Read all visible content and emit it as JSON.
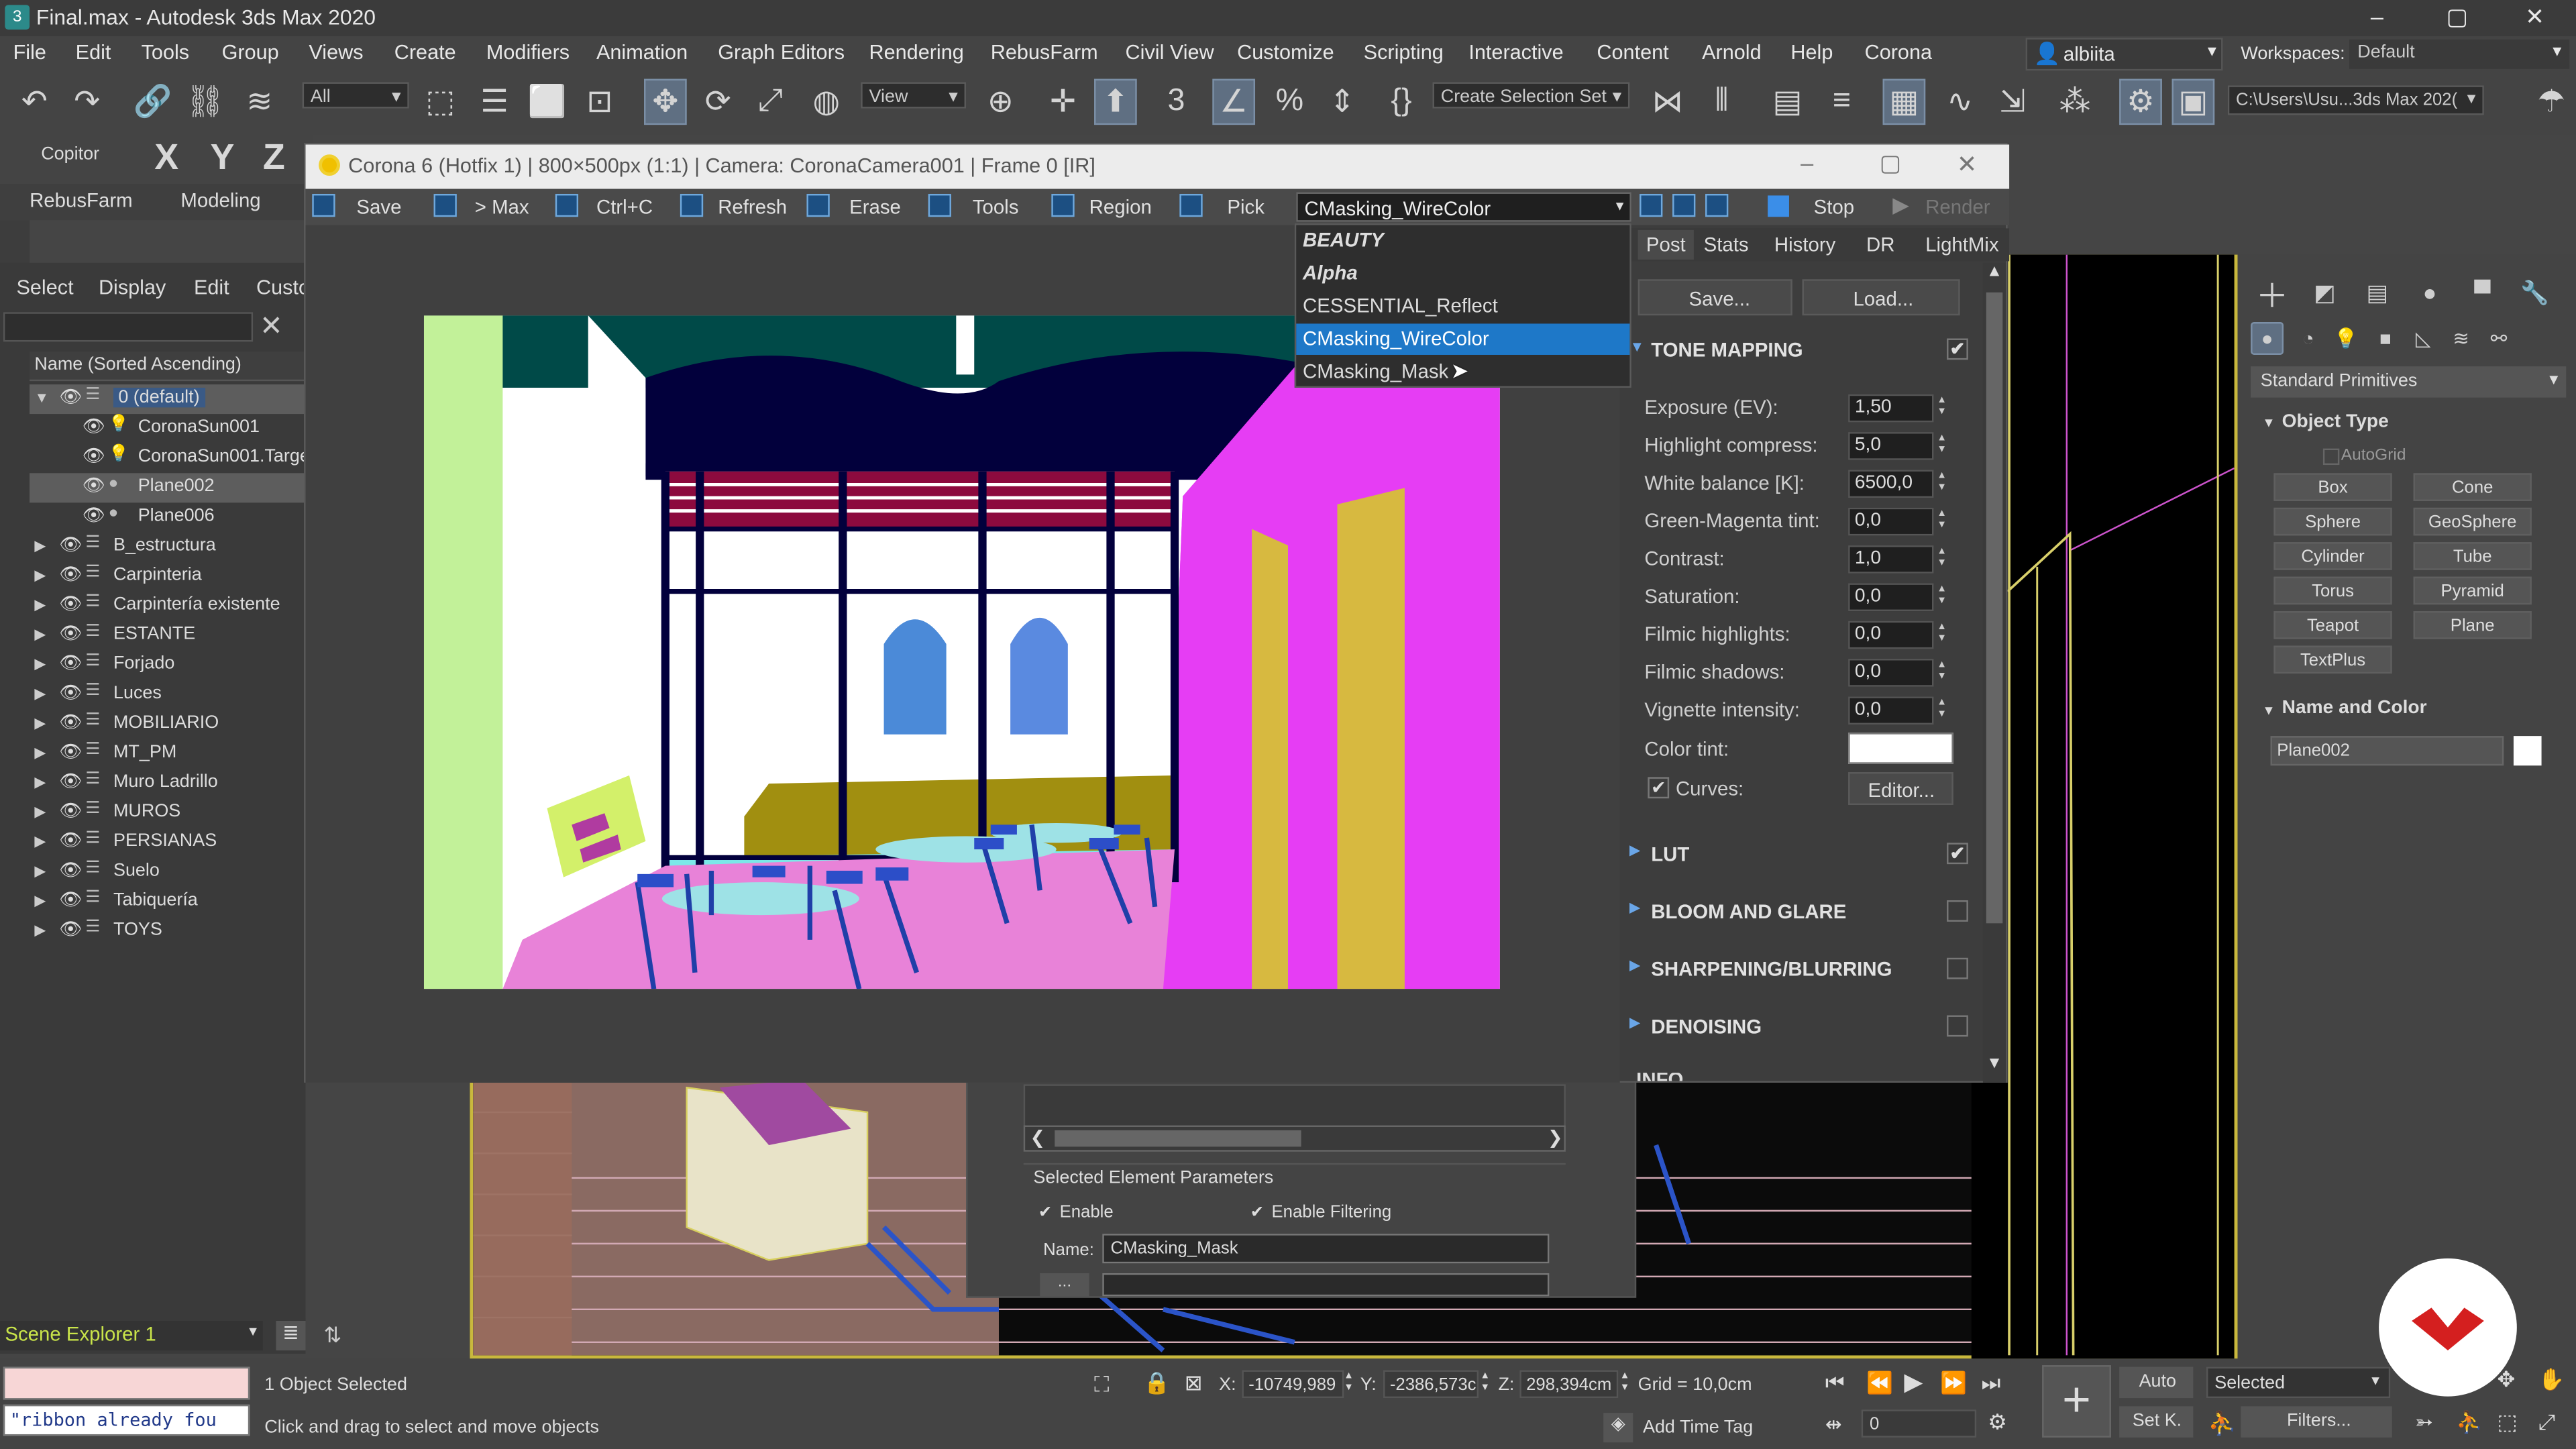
{
  "app": {
    "title": "Final.max - Autodesk 3ds Max 2020",
    "window_controls": [
      "–",
      "▢",
      "✕"
    ]
  },
  "menu": [
    "File",
    "Edit",
    "Tools",
    "Group",
    "Views",
    "Create",
    "Modifiers",
    "Animation",
    "Graph Editors",
    "Rendering",
    "RebusFarm",
    "Civil View",
    "Customize",
    "Scripting",
    "Interactive",
    "Content",
    "Arnold",
    "Help",
    "Corona"
  ],
  "user": {
    "name": "albiita"
  },
  "workspaces": {
    "label": "Workspaces:",
    "value": "Default"
  },
  "toolbar": {
    "filter": "All",
    "view": "View",
    "selection_set": "Create Selection Set",
    "path": "C:\\Users\\Usu...3ds Max 202("
  },
  "secondary": {
    "copitor": "Copitor",
    "axes": [
      "X",
      "Y",
      "Z"
    ],
    "tabs": [
      "RebusFarm",
      "Modeling"
    ]
  },
  "scene_explorer": {
    "tabs": [
      "Select",
      "Display",
      "Edit",
      "Custo"
    ],
    "header": "Name (Sorted Ascending)",
    "footer": "Scene Explorer 1",
    "items": [
      {
        "name": "0 (default)",
        "level": 0,
        "expanded": true,
        "selected": true,
        "icon": "layer-icon"
      },
      {
        "name": "CoronaSun001",
        "level": 1,
        "icon": "sun-icon"
      },
      {
        "name": "CoronaSun001.Targe",
        "level": 1,
        "icon": "sun-icon"
      },
      {
        "name": "Plane002",
        "level": 1,
        "selected": true,
        "icon": "sphere-icon"
      },
      {
        "name": "Plane006",
        "level": 1,
        "icon": "sphere-icon"
      },
      {
        "name": "B_estructura",
        "level": 0,
        "icon": "layer-icon"
      },
      {
        "name": "Carpinteria",
        "level": 0,
        "icon": "layer-icon"
      },
      {
        "name": "Carpintería existente",
        "level": 0,
        "icon": "layer-icon"
      },
      {
        "name": "ESTANTE",
        "level": 0,
        "icon": "layer-icon"
      },
      {
        "name": "Forjado",
        "level": 0,
        "icon": "layer-icon"
      },
      {
        "name": "Luces",
        "level": 0,
        "icon": "layer-icon"
      },
      {
        "name": "MOBILIARIO",
        "level": 0,
        "icon": "layer-icon"
      },
      {
        "name": "MT_PM",
        "level": 0,
        "icon": "layer-icon"
      },
      {
        "name": "Muro Ladrillo",
        "level": 0,
        "icon": "layer-icon"
      },
      {
        "name": "MUROS",
        "level": 0,
        "icon": "layer-icon"
      },
      {
        "name": "PERSIANAS",
        "level": 0,
        "icon": "layer-icon"
      },
      {
        "name": "Suelo",
        "level": 0,
        "icon": "layer-icon"
      },
      {
        "name": "Tabiquería",
        "level": 0,
        "icon": "layer-icon"
      },
      {
        "name": "TOYS",
        "level": 0,
        "icon": "layer-icon"
      }
    ]
  },
  "vfb": {
    "title": "Corona 6 (Hotfix 1) | 800×500px (1:1) | Camera: CoronaCamera001 | Frame 0 [IR]",
    "toolbar": [
      "Save",
      "> Max",
      "Ctrl+C",
      "Refresh",
      "Erase",
      "Tools",
      "Region",
      "Pick"
    ],
    "element": "CMasking_WireColor",
    "stop": "Stop",
    "render": "Render",
    "tabs": [
      "Post",
      "Stats",
      "History",
      "DR",
      "LightMix"
    ],
    "save_btn": "Save...",
    "load_btn": "Load...",
    "dropdown": [
      {
        "label": "BEAUTY",
        "style": "bold-italic"
      },
      {
        "label": "Alpha",
        "style": "bold-italic"
      },
      {
        "label": "CESSENTIAL_Reflect",
        "style": "normal"
      },
      {
        "label": "CMasking_WireColor",
        "style": "selected"
      },
      {
        "label": "CMasking_Mask",
        "style": "normal"
      }
    ],
    "tone_mapping": {
      "title": "TONE MAPPING",
      "params": [
        {
          "label": "Exposure (EV):",
          "value": "1,50"
        },
        {
          "label": "Highlight compress:",
          "value": "5,0"
        },
        {
          "label": "White balance [K]:",
          "value": "6500,0"
        },
        {
          "label": "Green-Magenta tint:",
          "value": "0,0"
        },
        {
          "label": "Contrast:",
          "value": "1,0"
        },
        {
          "label": "Saturation:",
          "value": "0,0"
        },
        {
          "label": "Filmic highlights:",
          "value": "0,0"
        },
        {
          "label": "Filmic shadows:",
          "value": "0,0"
        },
        {
          "label": "Vignette intensity:",
          "value": "0,0"
        }
      ],
      "color_tint": "Color tint:",
      "curves": "Curves:",
      "editor": "Editor..."
    },
    "sections": [
      {
        "label": "LUT",
        "checked": true
      },
      {
        "label": "BLOOM AND GLARE",
        "checked": false
      },
      {
        "label": "SHARPENING/BLURRING",
        "checked": false
      },
      {
        "label": "DENOISING",
        "checked": false
      }
    ],
    "cut_label": "INFO"
  },
  "render_elements": {
    "group": "Selected Element Parameters",
    "enable": "Enable",
    "enable_filtering": "Enable Filtering",
    "name_label": "Name:",
    "name_value": "CMasking_Mask",
    "dots": "..."
  },
  "command_panel": {
    "category": "Standard Primitives",
    "object_type": "Object Type",
    "autogrid": "AutoGrid",
    "buttons": [
      "Box",
      "Cone",
      "Sphere",
      "GeoSphere",
      "Cylinder",
      "Tube",
      "Torus",
      "Pyramid",
      "Teapot",
      "Plane",
      "TextPlus"
    ],
    "name_and_color": "Name and Color",
    "object_name": "Plane002"
  },
  "status": {
    "script_output": "\"ribbon already fou",
    "selected": "1 Object Selected",
    "prompt": "Click and drag to select and move objects",
    "x_label": "X:",
    "x": "-10749,989",
    "y_label": "Y:",
    "y": "-2386,573c",
    "z_label": "Z:",
    "z": "298,394cm",
    "grid": "Grid = 10,0cm",
    "add_time_tag": "Add Time Tag",
    "auto": "Auto",
    "set_k": "Set K.",
    "selected_dd": "Selected",
    "filters": "Filters...",
    "frame": "0"
  },
  "colors": {
    "accent_selection": "#1e78c8",
    "viewport_border": "#c9b83d",
    "vfb_highlight": "#6aa6e8"
  }
}
